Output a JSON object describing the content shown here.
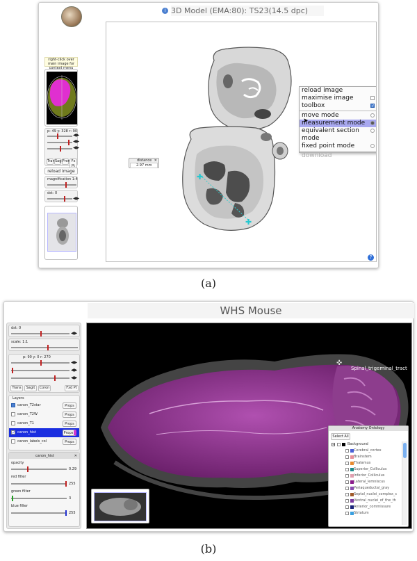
{
  "panel_a": {
    "title": "3D Model (EMA:80): TS23(14.5 dpc)",
    "hint": "right-click over main image for context menu",
    "coords": "p: 49   y: 328   r: 90",
    "view_buttons": [
      "Trans",
      "Sagit",
      "Front",
      "Fx Pt"
    ],
    "reload_label": "reload image",
    "magnification_label": "magnification 1:4",
    "dst_label": "dst: 0",
    "distance_title": "distance",
    "distance_value": "2.97 mm",
    "context_menu": [
      {
        "label": "reload image",
        "mark": "none"
      },
      {
        "label": "maximise image",
        "mark": "box"
      },
      {
        "label": "toolbox",
        "mark": "checked"
      },
      {
        "label": "move mode",
        "mark": "radio"
      },
      {
        "label": "measurement mode",
        "mark": "radio-selected"
      },
      {
        "label": "equivalent section mode",
        "mark": "radio"
      },
      {
        "label": "fixed point mode",
        "mark": "radio"
      },
      {
        "label": "download",
        "mark": "disabled"
      }
    ],
    "caption": "(a)"
  },
  "panel_b": {
    "title": "WHS Mouse",
    "dst_label": "dst: 0",
    "scale_label": "scale: 1:1",
    "coords": "p: 90   y: 0   r: 270",
    "view_buttons": [
      "Trans",
      "Sagit",
      "Coron",
      "Fxd Pt"
    ],
    "layers_title": "Layers",
    "layers": [
      {
        "name": "canon_T2star",
        "checked": true,
        "selected": false
      },
      {
        "name": "canon_T2W",
        "checked": false,
        "selected": false
      },
      {
        "name": "canon_T1",
        "checked": false,
        "selected": false
      },
      {
        "name": "canon_hist",
        "checked": true,
        "selected": true
      },
      {
        "name": "canon_labels_col",
        "checked": false,
        "selected": false
      }
    ],
    "props_label": "Props",
    "hist_panel_title": "canon_hist",
    "opacity_label": "opacity",
    "opacity_value": "0.29",
    "red_label": "red filter",
    "red_value": "255",
    "green_label": "green filter",
    "green_value": "3",
    "blue_label": "blue filter",
    "blue_value": "255",
    "anatomy_label": "Spinal_trigeminal_tract",
    "ontology_title": "Anatomy Ontology",
    "select_all": "Select All",
    "ontology_root": "Background",
    "ontology_items": [
      {
        "name": "Cerebral_cortex",
        "color": "#4a5fd6"
      },
      {
        "name": "Brainstem",
        "color": "#e8909a"
      },
      {
        "name": "Thalamus",
        "color": "#e88a30"
      },
      {
        "name": "Superior_Colliculus",
        "color": "#1c8a8a"
      },
      {
        "name": "Inferior_Colliculus",
        "color": "#e0a0b0"
      },
      {
        "name": "Lateral_lemniscus",
        "color": "#8b1b8b"
      },
      {
        "name": "Periaqueductal_gray",
        "color": "#8a4db0"
      },
      {
        "name": "Septal_nuclei_complex_c",
        "color": "#a05a2a"
      },
      {
        "name": "Ventral_nuclei_of_the_th",
        "color": "#7a3aa0"
      },
      {
        "name": "Anterior_commissure",
        "color": "#1a237a"
      },
      {
        "name": "Striatum",
        "color": "#3aa0e0"
      }
    ],
    "caption": "(b)"
  }
}
